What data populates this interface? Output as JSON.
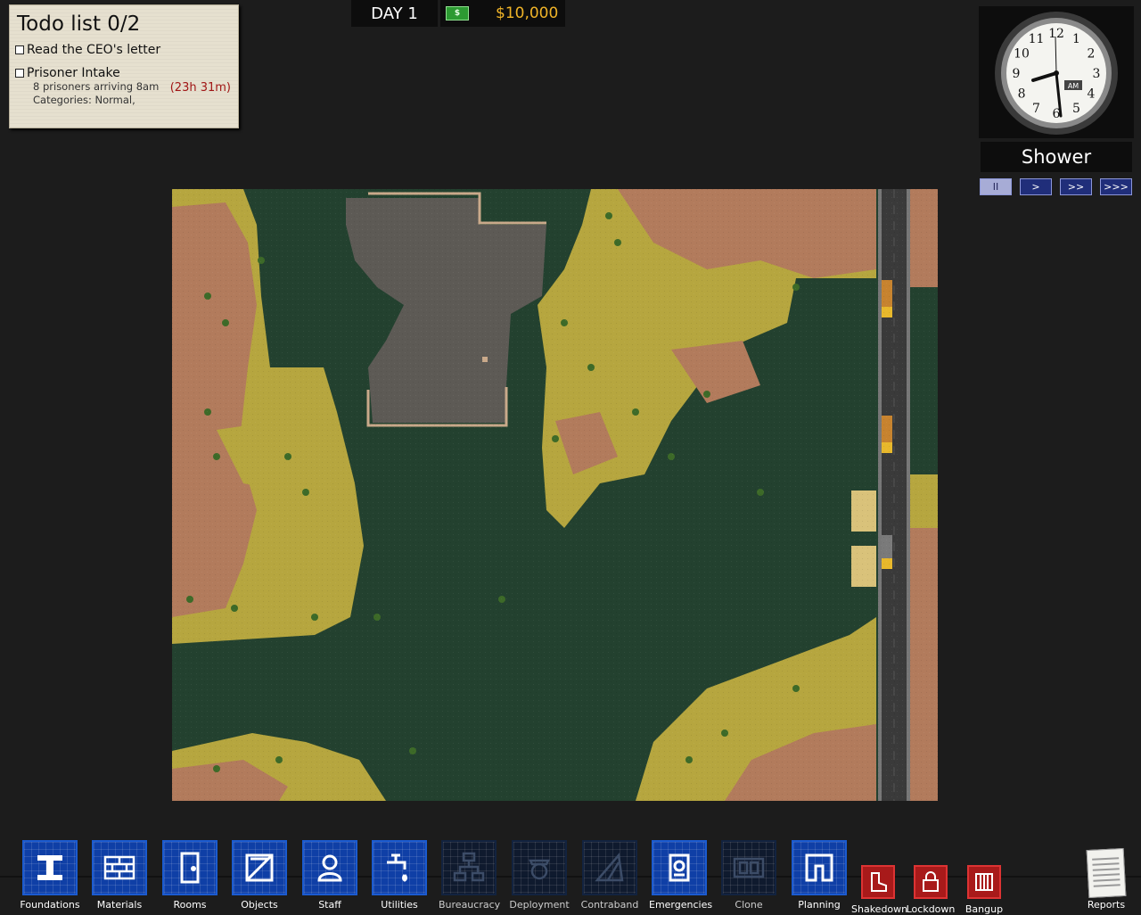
{
  "todo": {
    "title": "Todo list 0/2",
    "items": [
      {
        "label": "Read the CEO's letter"
      },
      {
        "label": "Prisoner Intake",
        "sub1": "8 prisoners arriving 8am",
        "sub2": "Categories: Normal,",
        "timer": "(23h 31m)"
      }
    ]
  },
  "topbar": {
    "day": "DAY 1",
    "cash_icon": "$",
    "money": "$10,000"
  },
  "clock": {
    "numerals": [
      "12",
      "1",
      "2",
      "3",
      "4",
      "5",
      "6",
      "7",
      "8",
      "9",
      "10",
      "11"
    ],
    "ampm": "AM"
  },
  "regime": "Shower",
  "speed": [
    {
      "label": "II",
      "active": true
    },
    {
      "label": ">"
    },
    {
      "label": ">>"
    },
    {
      "label": ">>>"
    }
  ],
  "toolbar": {
    "tools": [
      {
        "label": "Foundations",
        "icon": "foundations-icon",
        "enabled": true
      },
      {
        "label": "Materials",
        "icon": "bricks-icon",
        "enabled": true
      },
      {
        "label": "Rooms",
        "icon": "door-icon",
        "enabled": true
      },
      {
        "label": "Objects",
        "icon": "crate-icon",
        "enabled": true
      },
      {
        "label": "Staff",
        "icon": "staff-icon",
        "enabled": true
      },
      {
        "label": "Utilities",
        "icon": "tap-icon",
        "enabled": true
      },
      {
        "label": "Bureaucracy",
        "icon": "org-chart-icon",
        "enabled": false
      },
      {
        "label": "Deployment",
        "icon": "guard-icon",
        "enabled": false
      },
      {
        "label": "Contraband",
        "icon": "contraband-icon",
        "enabled": false
      },
      {
        "label": "Emergencies",
        "icon": "alarm-icon",
        "enabled": true
      },
      {
        "label": "Clone",
        "icon": "clone-icon",
        "enabled": false
      },
      {
        "label": "Planning",
        "icon": "planning-icon",
        "enabled": true
      }
    ],
    "red_tools": [
      {
        "label": "Shakedown",
        "icon": "boot-icon"
      },
      {
        "label": "Lockdown",
        "icon": "padlock-icon"
      },
      {
        "label": "Bangup",
        "icon": "cell-icon"
      }
    ],
    "reports": {
      "label": "Reports",
      "icon": "reports-icon"
    }
  },
  "colors": {
    "water": "#23412f",
    "grass": "#b6a63f",
    "dirt": "#b27b5c",
    "concrete": "#5d5a55",
    "road": "#3a3a3a",
    "tool_blue": "#0f3fa6",
    "alert_red": "#a81a1a",
    "money": "#f0b428"
  }
}
